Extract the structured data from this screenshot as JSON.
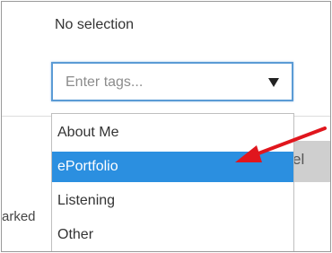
{
  "selection_status": "No selection",
  "tags_input": {
    "placeholder": "Enter tags...",
    "value": ""
  },
  "dropdown": {
    "options": [
      "About Me",
      "ePortfolio",
      "Listening",
      "Other"
    ],
    "highlighted": "ePortfolio"
  },
  "partial_button_label": "el",
  "partial_text": "arked",
  "colors": {
    "focus_border": "#5b9bd5",
    "highlight": "#2b8fe0",
    "annotation_arrow": "#e0161d"
  },
  "icons": {
    "caret": "caret-down-icon",
    "arrow": "annotation-arrow-icon"
  }
}
